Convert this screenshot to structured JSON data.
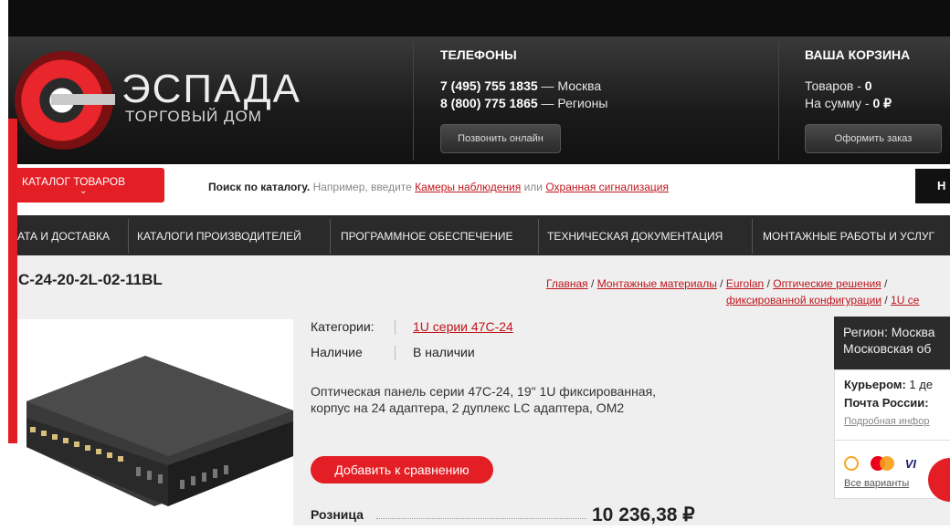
{
  "logo": {
    "name": "ЭСПАДА",
    "subtitle": "ТОРГОВЫЙ ДОМ"
  },
  "phones": {
    "title": "ТЕЛЕФОНЫ",
    "line1_num": "7 (495) 755 1835",
    "line1_city": "— Москва",
    "line2_num": "8 (800) 775 1865",
    "line2_city": "— Регионы",
    "call_btn": "Позвонить онлайн"
  },
  "cart": {
    "title": "ВАША КОРЗИНА",
    "items_label": "Товаров - ",
    "items_value": "0",
    "sum_label": "На сумму - ",
    "sum_value": "0 ₽",
    "order_btn": "Оформить заказ"
  },
  "catalog_btn": {
    "label": "КАТАЛОГ ТОВАРОВ",
    "chevron": "⌄"
  },
  "search": {
    "bold": "Поиск по каталогу.",
    "hint": " Например, введите ",
    "link1": "Камеры наблюдения",
    "or": " или ",
    "link2": "Охранная сигнализация",
    "button": "Н"
  },
  "nav": [
    "АТА И ДОСТАВКА",
    "КАТАЛОГИ ПРОИЗВОДИТЕЛЕЙ",
    "ПРОГРАММНОЕ ОБЕСПЕЧЕНИЕ",
    "ТЕХНИЧЕСКАЯ ДОКУМЕНТАЦИЯ",
    "МОНТАЖНЫЕ РАБОТЫ И УСЛУГ"
  ],
  "product": {
    "title": "С-24-20-2L-02-11BL",
    "breadcrumbs": [
      "Главная",
      "Монтажные материалы",
      "Eurolan",
      "Оптические решения",
      "фиксированной конфигурации",
      "1U се"
    ],
    "categories_label": "Категории:",
    "categories_value": "1U серии 47С-24",
    "availability_label": "Наличие",
    "availability_value": "В наличии",
    "description": "Оптическая панель серии 47С-24, 19\" 1U фиксированная, корпус на 24 адаптера, 2 дуплекс LC адаптера, OM2",
    "compare_btn": "Добавить к сравнению",
    "price_label": "Розница",
    "price_value": "10 236,38 ₽"
  },
  "delivery": {
    "region_l1": "Регион: Москва",
    "region_l2": "Московская об",
    "courier_label": "Курьером:",
    "courier_value": " 1 де",
    "post_label": "Почта России:",
    "post_value": " ",
    "details_link": "Подробная инфор",
    "all_variants": "Все варианты"
  }
}
